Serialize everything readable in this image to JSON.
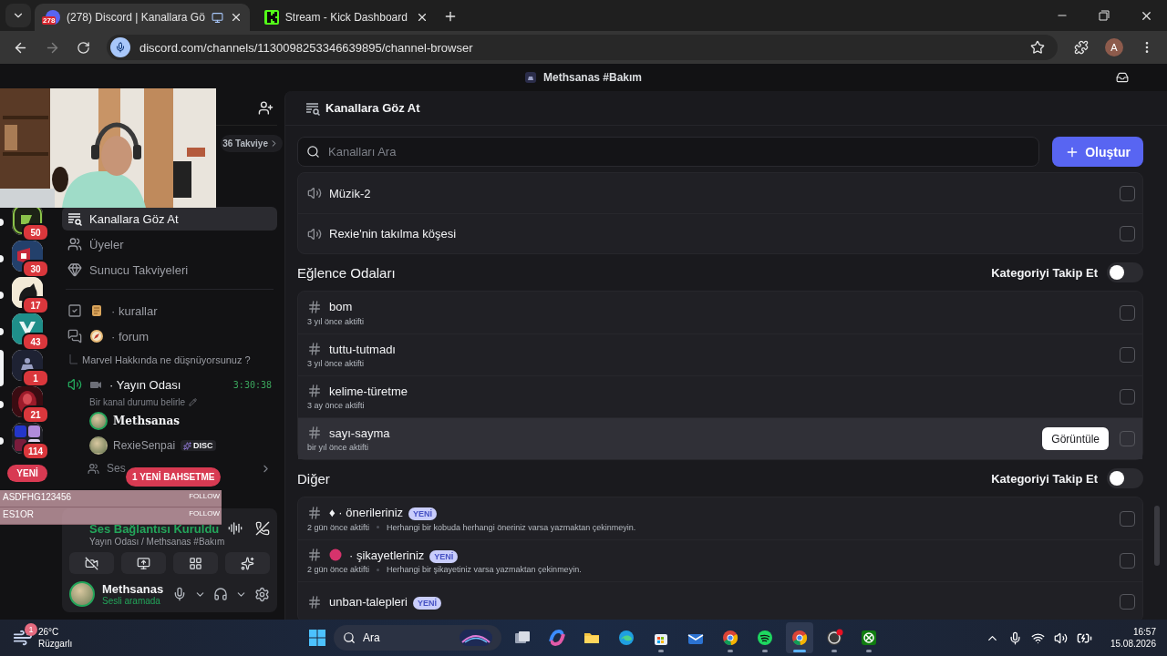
{
  "browser": {
    "tabs": [
      {
        "title": "(278) Discord | Kanallara Gö",
        "favicon_badge": "278",
        "kind": "discord",
        "sharing": true,
        "selected": true
      },
      {
        "title": "Stream - Kick Dashboard",
        "kind": "kick",
        "sharing": false,
        "selected": false
      }
    ],
    "url": "discord.com/channels/1130098253346639895/channel-browser",
    "profile": "A"
  },
  "overlay_alerts": [
    {
      "name": "ASDFHG123456",
      "action": "FOLLOW"
    },
    {
      "name": "ES1OR",
      "action": "FOLLOW"
    }
  ],
  "discord": {
    "title": "Methsanas #Bakım",
    "servers": [
      {
        "kind": "g",
        "badge": "50",
        "unread": true,
        "selected": false
      },
      {
        "kind": "red",
        "badge": "30",
        "unread": true,
        "selected": false
      },
      {
        "kind": "cream",
        "badge": "17",
        "unread": true,
        "selected": false
      },
      {
        "kind": "teal",
        "badge": "43",
        "unread": true,
        "selected": false
      },
      {
        "kind": "navy",
        "badge": "1",
        "unread": false,
        "selected": true
      },
      {
        "kind": "crimson",
        "badge": "21",
        "unread": true,
        "selected": false
      },
      {
        "kind": "folder",
        "badge": "114",
        "unread": true,
        "selected": false
      }
    ],
    "servers_new": "YENİ",
    "boost": "36 Takviye",
    "nav": [
      {
        "kind": "browse",
        "label": "Kanallara Göz At",
        "selected": true
      },
      {
        "kind": "members",
        "label": "Üyeler",
        "selected": false
      },
      {
        "kind": "boosts",
        "label": "Sunucu Takviyeleri",
        "selected": false
      }
    ],
    "channels": [
      {
        "kind": "rules",
        "name": "· kurallar"
      },
      {
        "kind": "forum",
        "name": "· forum"
      }
    ],
    "thread": "Marvel Hakkında ne düşnüyorsunuz ?",
    "voice": {
      "name": "· Yayın Odası",
      "timer": "3:30:38",
      "status_hint": "Bir kanal durumu belirle",
      "members": [
        {
          "name": "Methsanas",
          "speaking": true
        },
        {
          "name": "RexieSenpai",
          "speaking": false,
          "tag": "DISC"
        }
      ]
    },
    "more_row": "Ses",
    "mention_pill": "1 YENİ BAHSETME",
    "connection": {
      "status": "Ses Bağlantısı Kuruldu",
      "location": "Yayın Odası / Methsanas #Bakım"
    },
    "user": {
      "name": "Methsanas",
      "status": "Sesli aramada"
    }
  },
  "channel_browser": {
    "title": "Kanallara Göz At",
    "search_placeholder": "Kanalları Ara",
    "create": "Oluştur",
    "groups": [
      {
        "rows": [
          {
            "kind": "voice",
            "name": "Müzik-2",
            "checked": false,
            "hovered": false
          },
          {
            "kind": "voice",
            "name": "Rexie'nin takılma köşesi",
            "checked": false,
            "hovered": false
          }
        ]
      },
      {
        "title": "Eğlence Odaları",
        "follow_label": "Kategoriyi Takip Et",
        "follow_on": false,
        "rows": [
          {
            "kind": "text",
            "name": "bom",
            "activity": "3 yıl önce aktifti",
            "checked": false,
            "hovered": false
          },
          {
            "kind": "text",
            "name": "tuttu-tutmadı",
            "activity": "3 yıl önce aktifti",
            "checked": false,
            "hovered": false
          },
          {
            "kind": "text",
            "name": "kelime-türetme",
            "activity": "3 ay önce aktifti",
            "checked": false,
            "hovered": false
          },
          {
            "kind": "text",
            "name": "sayı-sayma",
            "activity": "bir yıl önce aktifti",
            "checked": false,
            "hovered": true,
            "action": "Görüntüle"
          }
        ]
      },
      {
        "title": "Diğer",
        "follow_label": "Kategoriyi Takip Et",
        "follow_on": false,
        "rows": [
          {
            "kind": "text",
            "name": "♦ · önerileriniz",
            "badge": "YENİ",
            "activity": "2 gün önce aktifti",
            "description": "Herhangi bir kobuda herhangi öneriniz varsa yazmaktan çekinmeyin.",
            "checked": false,
            "hovered": false
          },
          {
            "kind": "text",
            "color": "#d6336c",
            "name": "· şikayetleriniz",
            "badge": "YENİ",
            "activity": "2 gün önce aktifti",
            "description": "Herhangi bir şikayetiniz varsa yazmaktan çekinmeyin.",
            "checked": false,
            "hovered": false
          },
          {
            "kind": "text",
            "name": "unban-talepleri",
            "badge": "YENİ",
            "checked": false,
            "hovered": false
          }
        ]
      }
    ]
  },
  "taskbar": {
    "weather": {
      "temp": "26°C",
      "desc": "Rüzgarlı",
      "badge": "1"
    },
    "search": "Ara",
    "apps": [
      {
        "kind": "taskview",
        "running": false,
        "active": false
      },
      {
        "kind": "copilot",
        "running": false,
        "active": false
      },
      {
        "kind": "explorer",
        "running": false,
        "active": false
      },
      {
        "kind": "edge",
        "running": false,
        "active": false
      },
      {
        "kind": "store",
        "running": true,
        "active": false
      },
      {
        "kind": "mail",
        "running": false,
        "active": false
      },
      {
        "kind": "chrome",
        "running": true,
        "active": false
      },
      {
        "kind": "spotify",
        "running": true,
        "active": false
      },
      {
        "kind": "chrome",
        "running": true,
        "active": true
      },
      {
        "kind": "obs",
        "running": true,
        "active": false
      },
      {
        "kind": "xbox",
        "running": true,
        "active": false
      }
    ],
    "time": "16:57",
    "date": "15.08.2026"
  }
}
